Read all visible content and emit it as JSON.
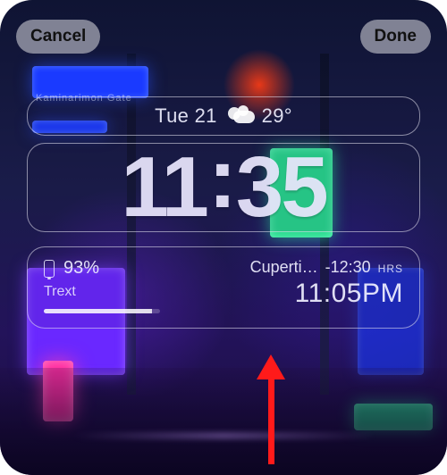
{
  "topbar": {
    "cancel": "Cancel",
    "done": "Done"
  },
  "date_row": {
    "weekday_day": "Tue 21",
    "temperature": "29°",
    "weather_icon": "partly-cloudy"
  },
  "clock": {
    "hh": "11",
    "mm": "35"
  },
  "widgets": {
    "battery": {
      "percent_text": "93%",
      "label": "Trext",
      "level_pct": 93
    },
    "world_clock": {
      "city_truncated": "Cuperti…",
      "offset": "-12:30",
      "offset_unit": "HRS",
      "time": "11:05PM"
    }
  },
  "bg_label": "Kaminarimon Gate"
}
